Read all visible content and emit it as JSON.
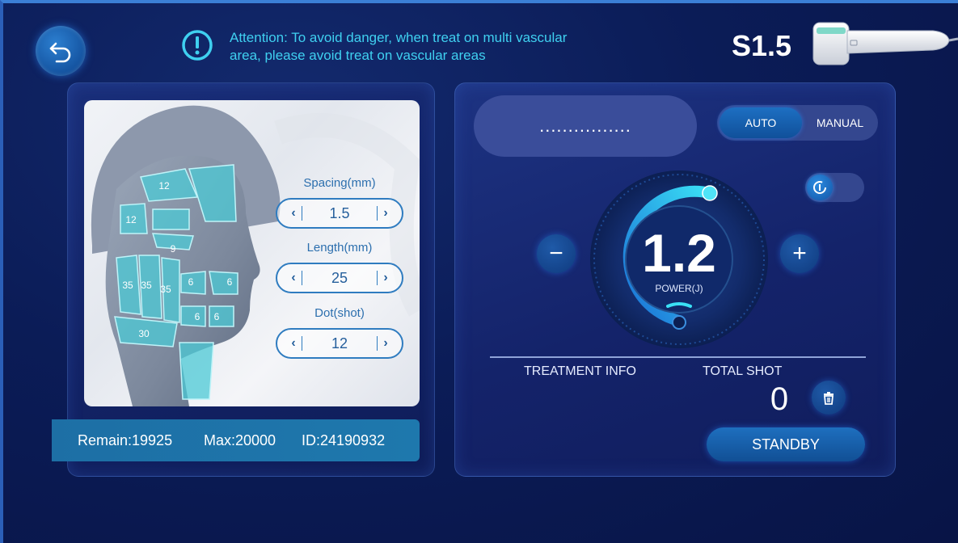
{
  "header": {
    "attention_text": "Attention:  To avoid danger, when treat on multi vascular area, please avoid treat on vascular areas",
    "model": "S1.5",
    "back_icon": "back-arrow-icon",
    "attention_icon": "exclamation-circle-icon"
  },
  "face_map": {
    "zones": {
      "forehead": "12",
      "temple": "12",
      "under_eye": "9",
      "cheek_a": "35",
      "cheek_b": "35",
      "cheek_c": "35",
      "nose_left": "6",
      "nose_right": "6",
      "chin_left": "6",
      "chin_right": "6",
      "jaw": "30"
    }
  },
  "params": {
    "spacing": {
      "label": "Spacing(mm)",
      "value": "1.5",
      "dec": "‹",
      "inc": "›"
    },
    "length": {
      "label": "Length(mm)",
      "value": "25",
      "dec": "‹",
      "inc": "›"
    },
    "dot": {
      "label": "Dot(shot)",
      "value": "12",
      "dec": "‹",
      "inc": "›"
    }
  },
  "info_bar": {
    "remain": "Remain:19925",
    "max": "Max:20000",
    "id": "ID:24190932"
  },
  "control": {
    "password_mask": "................",
    "mode_auto": "AUTO",
    "mode_manual": "MANUAL",
    "selected_mode": "AUTO",
    "minus": "−",
    "plus": "+",
    "power_value": "1.2",
    "power_unit": "POWER(J)",
    "treatment_info_label": "TREATMENT INFO",
    "total_shot_label": "TOTAL SHOT",
    "total_shot_value": "0",
    "standby_label": "STANDBY"
  },
  "colors": {
    "background": "#0b1c57",
    "accent_cyan": "#3fd0f0",
    "button_blue": "#1a5fb0"
  }
}
